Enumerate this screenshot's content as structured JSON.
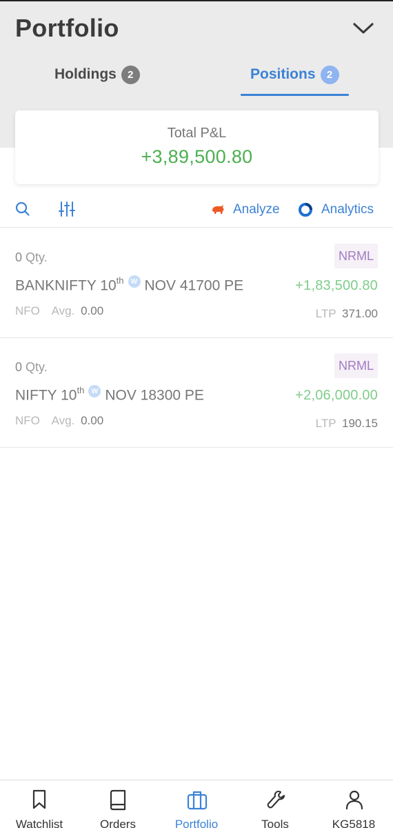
{
  "header": {
    "title": "Portfolio",
    "tabs": [
      {
        "label": "Holdings",
        "count": "2",
        "active": false
      },
      {
        "label": "Positions",
        "count": "2",
        "active": true
      }
    ]
  },
  "summary": {
    "label": "Total P&L",
    "value": "+3,89,500.80"
  },
  "toolbar": {
    "analyze_label": "Analyze",
    "analytics_label": "Analytics"
  },
  "positions": [
    {
      "qty": "0",
      "qty_label": "Qty.",
      "symbol": "BANKNIFTY 10",
      "day_suffix": "th",
      "weekly_badge": "W",
      "contract": "NOV 41700 PE",
      "exchange": "NFO",
      "avg_label": "Avg.",
      "avg": "0.00",
      "product": "NRML",
      "pnl": "+1,83,500.80",
      "ltp_label": "LTP",
      "ltp": "371.00"
    },
    {
      "qty": "0",
      "qty_label": "Qty.",
      "symbol": "NIFTY 10",
      "day_suffix": "th",
      "weekly_badge": "W",
      "contract": "NOV 18300 PE",
      "exchange": "NFO",
      "avg_label": "Avg.",
      "avg": "0.00",
      "product": "NRML",
      "pnl": "+2,06,000.00",
      "ltp_label": "LTP",
      "ltp": "190.15"
    }
  ],
  "bottom_nav": [
    {
      "label": "Watchlist",
      "icon": "bookmark-icon",
      "active": false
    },
    {
      "label": "Orders",
      "icon": "book-icon",
      "active": false
    },
    {
      "label": "Portfolio",
      "icon": "briefcase-icon",
      "active": true
    },
    {
      "label": "Tools",
      "icon": "wrench-icon",
      "active": false
    },
    {
      "label": "KG5818",
      "icon": "user-icon",
      "active": false
    }
  ],
  "colors": {
    "accent": "#3b82d6",
    "profit": "#4caf50",
    "product_tag": "#a37ac4",
    "header_bg": "#ebebeb"
  }
}
